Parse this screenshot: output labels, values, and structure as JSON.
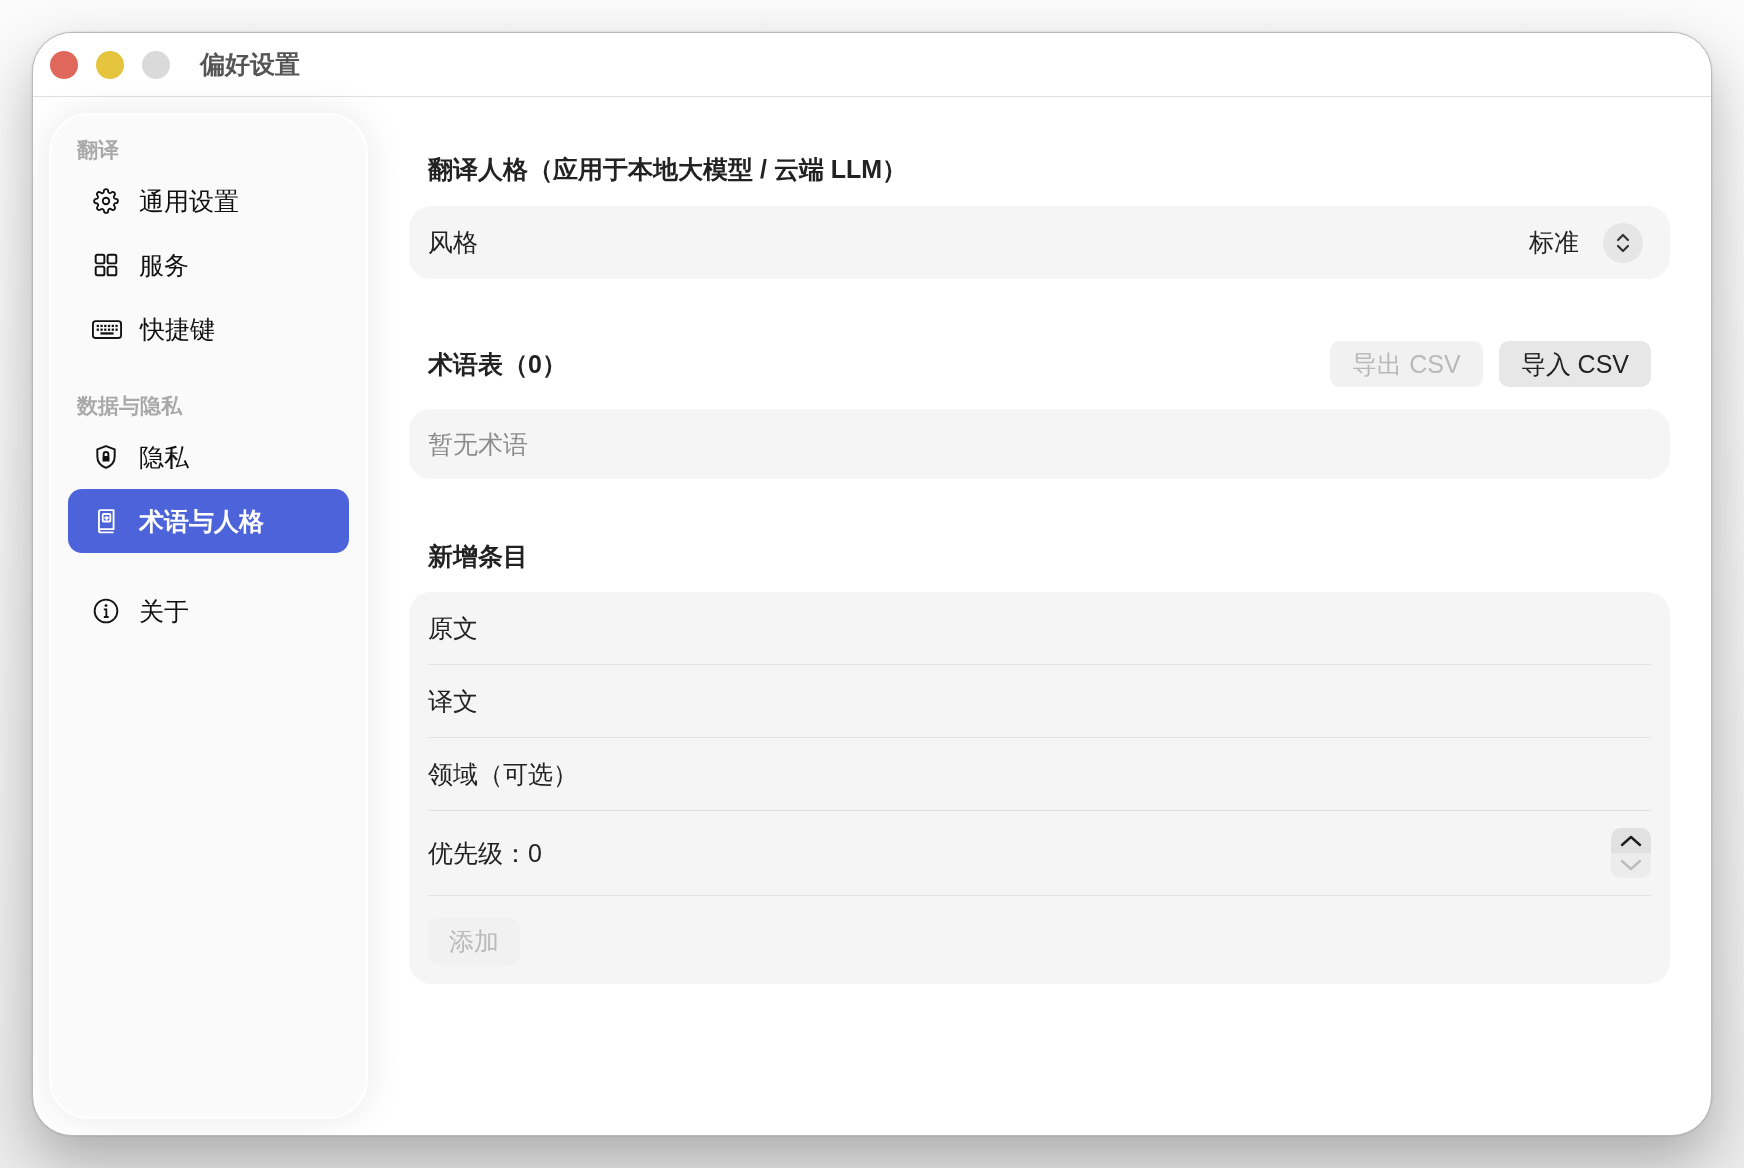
{
  "window": {
    "title": "偏好设置",
    "buttons": [
      {
        "kind": "close",
        "disabled": false
      },
      {
        "kind": "minimize",
        "disabled": false
      },
      {
        "kind": "zoom",
        "disabled": true
      }
    ]
  },
  "sidebar": {
    "sections": [
      {
        "title": "翻译",
        "items": [
          {
            "kind": "general",
            "label": "通用设置",
            "selected": false
          },
          {
            "kind": "services",
            "label": "服务",
            "selected": false
          },
          {
            "kind": "shortcuts",
            "label": "快捷键",
            "selected": false
          }
        ]
      },
      {
        "title": "数据与隐私",
        "items": [
          {
            "kind": "privacy",
            "label": "隐私",
            "selected": false
          },
          {
            "kind": "glossary",
            "label": "术语与人格",
            "selected": true
          }
        ]
      },
      {
        "items": [
          {
            "kind": "about",
            "label": "关于",
            "selected": false
          }
        ]
      }
    ]
  },
  "persona": {
    "heading": "翻译人格（应用于本地大模型 / 云端 LLM）",
    "style": {
      "label": "风格",
      "value": "标准"
    }
  },
  "glossary": {
    "heading": "术语表（0）",
    "buttons": [
      {
        "label": "导出 CSV",
        "disabled": true
      },
      {
        "label": "导入 CSV",
        "disabled": false
      }
    ],
    "empty_text": "暂无术语"
  },
  "new_entry": {
    "heading": "新增条目",
    "fields": [
      {
        "placeholder": "原文"
      },
      {
        "placeholder": "译文"
      },
      {
        "placeholder": "领域（可选）"
      }
    ],
    "priority": {
      "label": "优先级：0",
      "increment_disabled": false,
      "decrement_disabled": true
    },
    "add_button": {
      "label": "添加",
      "disabled": true
    }
  }
}
